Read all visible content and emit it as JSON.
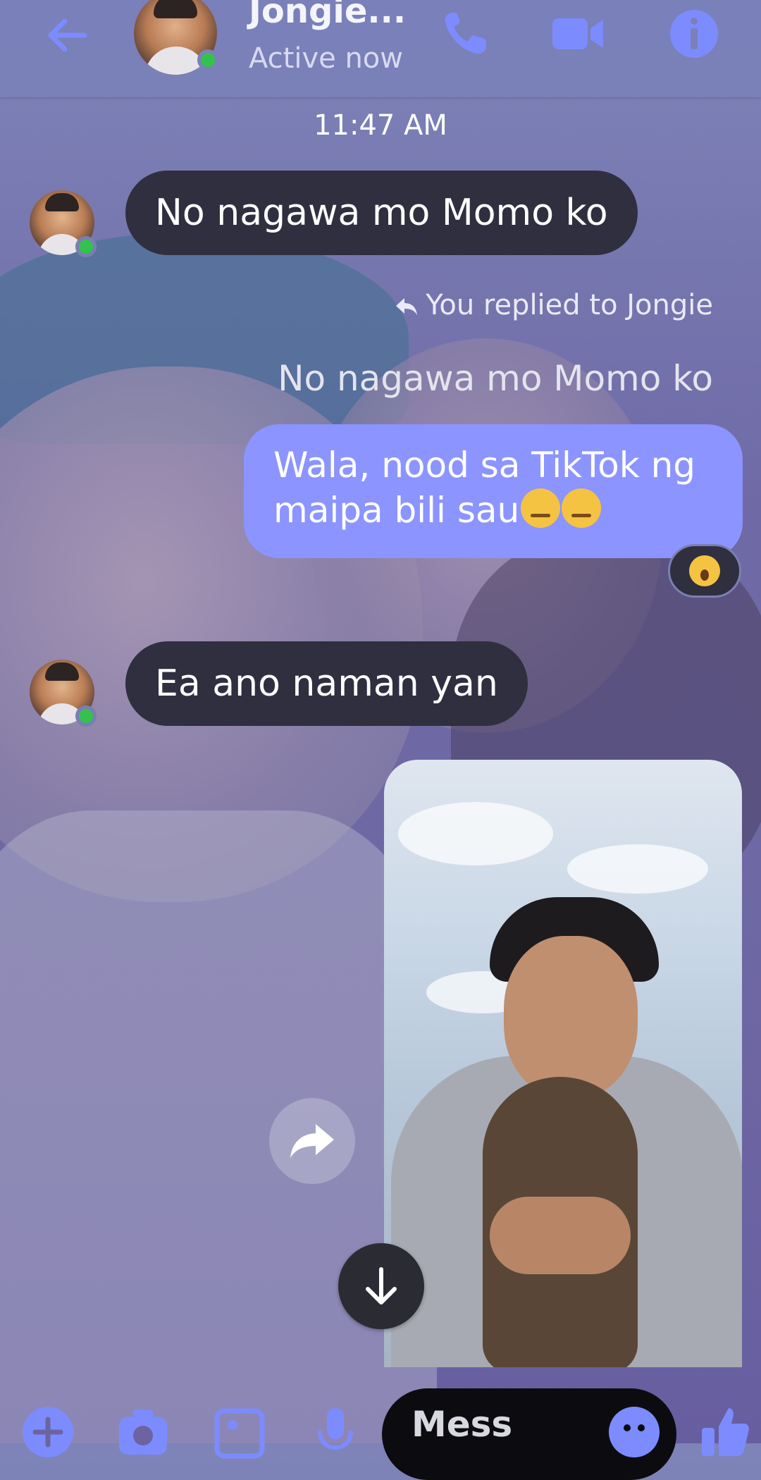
{
  "header": {
    "contact_name": "Jongie...",
    "status": "Active now",
    "icons": [
      "back-arrow-icon",
      "phone-icon",
      "video-camera-icon",
      "info-icon"
    ]
  },
  "conversation": {
    "timestamp": "11:47 AM",
    "messages": [
      {
        "direction": "incoming",
        "text": "No nagawa mo Momo ko"
      },
      {
        "direction": "outgoing",
        "reply_label": "You replied to Jongie",
        "quoted_text": "No nagawa mo Momo ko",
        "line1": "Wala, nood sa TikTok ng",
        "line2": "maipa bili sau",
        "reaction": "surprised-face-emoji"
      },
      {
        "direction": "incoming",
        "text": "Ea ano naman yan"
      },
      {
        "direction": "outgoing",
        "type": "photo"
      }
    ]
  },
  "composer": {
    "placeholder": "Mess",
    "icons": [
      "plus-icon",
      "camera-icon",
      "gallery-icon",
      "microphone-icon",
      "emoji-icon",
      "thumbs-up-icon"
    ]
  },
  "colors": {
    "accent": "#8c94ff",
    "incoming_bubble": "#2f2f3f",
    "online": "#33c24d"
  }
}
